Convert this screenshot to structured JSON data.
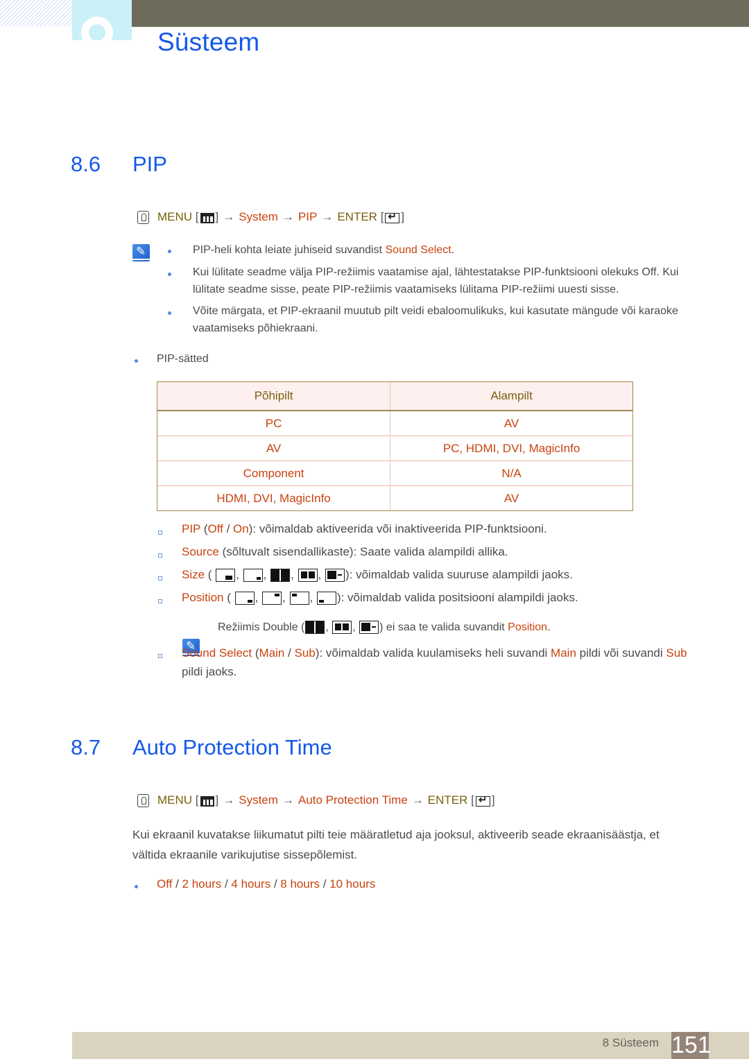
{
  "header": {
    "chapter_title": "Süsteem"
  },
  "section_pip": {
    "number": "8.6",
    "title": "PIP",
    "menu_path": {
      "menu": "MENU",
      "system": "System",
      "item": "PIP",
      "enter": "ENTER"
    },
    "notes": [
      {
        "text": "PIP-heli kohta leiate juhiseid suvandist ",
        "link": "Sound Select",
        "after": "."
      },
      {
        "text": "Kui lülitate seadme välja PIP-režiimis vaatamise ajal, lähtestatakse PIP-funktsiooni olekuks Off. Kui lülitate seadme sisse, peate PIP-režiimis vaatamiseks lülitama PIP-režiimi uuesti sisse."
      },
      {
        "text": "Võite märgata, et PIP-ekraanil muutub pilt veidi ebaloomulikuks, kui kasutate mängude või karaoke vaatamiseks põhiekraani."
      }
    ],
    "settings_label": "PIP-sätted",
    "table": {
      "headers": [
        "Põhipilt",
        "Alampilt"
      ],
      "rows": [
        [
          "PC",
          "AV"
        ],
        [
          "AV",
          "PC, HDMI, DVI, MagicInfo"
        ],
        [
          "Component",
          "N/A"
        ],
        [
          "HDMI, DVI, MagicInfo",
          "AV"
        ]
      ]
    },
    "options": {
      "pip": {
        "name": "PIP",
        "off": "Off",
        "on": "On",
        "desc": "): võimaldab aktiveerida või inaktiveerida PIP-funktsiooni."
      },
      "source": {
        "name": "Source",
        "desc": " (sõltuvalt sisendallikaste): Saate valida alampildi allika."
      },
      "size": {
        "name": "Size",
        "desc": "): võimaldab valida suuruse alampildi jaoks.",
        "icons": [
          "size-small-icon",
          "size-large-icon",
          "size-double-icon",
          "size-double-boxed-icon",
          "size-double-offset-icon"
        ]
      },
      "position": {
        "name": "Position",
        "desc": "): võimaldab valida positsiooni alampildi jaoks.",
        "icons": [
          "position-bottom-right-icon",
          "position-top-right-icon",
          "position-top-left-icon",
          "position-bottom-left-icon"
        ]
      },
      "double_note": {
        "before": "Režiimis Double (",
        "after": ") ei saa te valida suvandit ",
        "link": "Position",
        "end": "."
      },
      "sound_select": {
        "name": "Sound Select",
        "main": "Main",
        "sub": "Sub",
        "desc1": "): võimaldab valida kuulamiseks heli suvandi ",
        "desc2": " pildi või suvandi",
        "desc3": " pildi jaoks."
      }
    }
  },
  "section_apt": {
    "number": "8.7",
    "title": "Auto Protection Time",
    "menu_path": {
      "menu": "MENU",
      "system": "System",
      "item": "Auto Protection Time",
      "enter": "ENTER"
    },
    "description": "Kui ekraanil kuvatakse liikumatut pilti teie määratletud aja jooksul, aktiveerib seade ekraanisäästja, et vältida ekraanile varikujutise sissepõlemist.",
    "options": [
      "Off",
      "2 hours",
      "4 hours",
      "8 hours",
      "10 hours"
    ]
  },
  "footer": {
    "chapter": "8 Süsteem",
    "page": "151"
  },
  "colors": {
    "heading_blue": "#1459ea",
    "option_red": "#c8430f",
    "menu_olive": "#7a5f0c"
  }
}
